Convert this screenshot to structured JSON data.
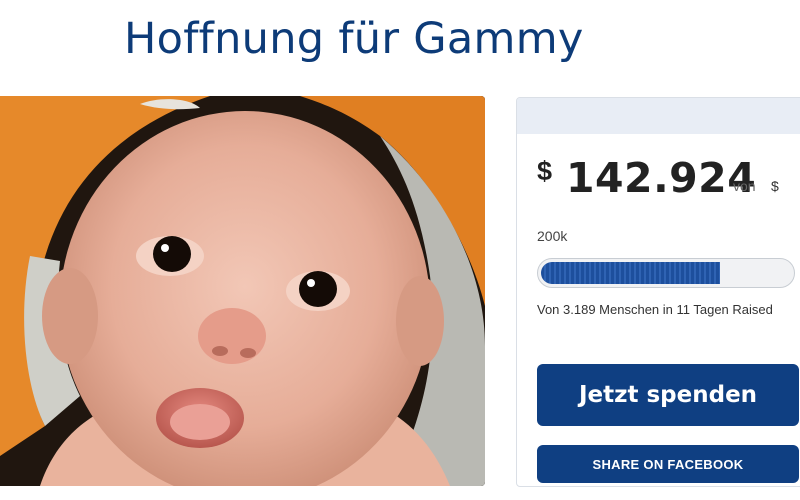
{
  "page": {
    "title": "Hoffnung für Gammy"
  },
  "campaign": {
    "currency_symbol": "$",
    "amount_raised": "142.924",
    "of_label": "von",
    "goal_currency": "$",
    "goal": "200k",
    "progress_fraction": 0.7146,
    "raised_text": "Von 3.189 Menschen in 11 Tagen Raised"
  },
  "buttons": {
    "donate_label": "Jetzt spenden",
    "facebook_label": "SHARE ON FACEBOOK"
  },
  "colors": {
    "title": "#0d3b78",
    "button": "#0f3f82",
    "progress": "#1d4f9d"
  }
}
